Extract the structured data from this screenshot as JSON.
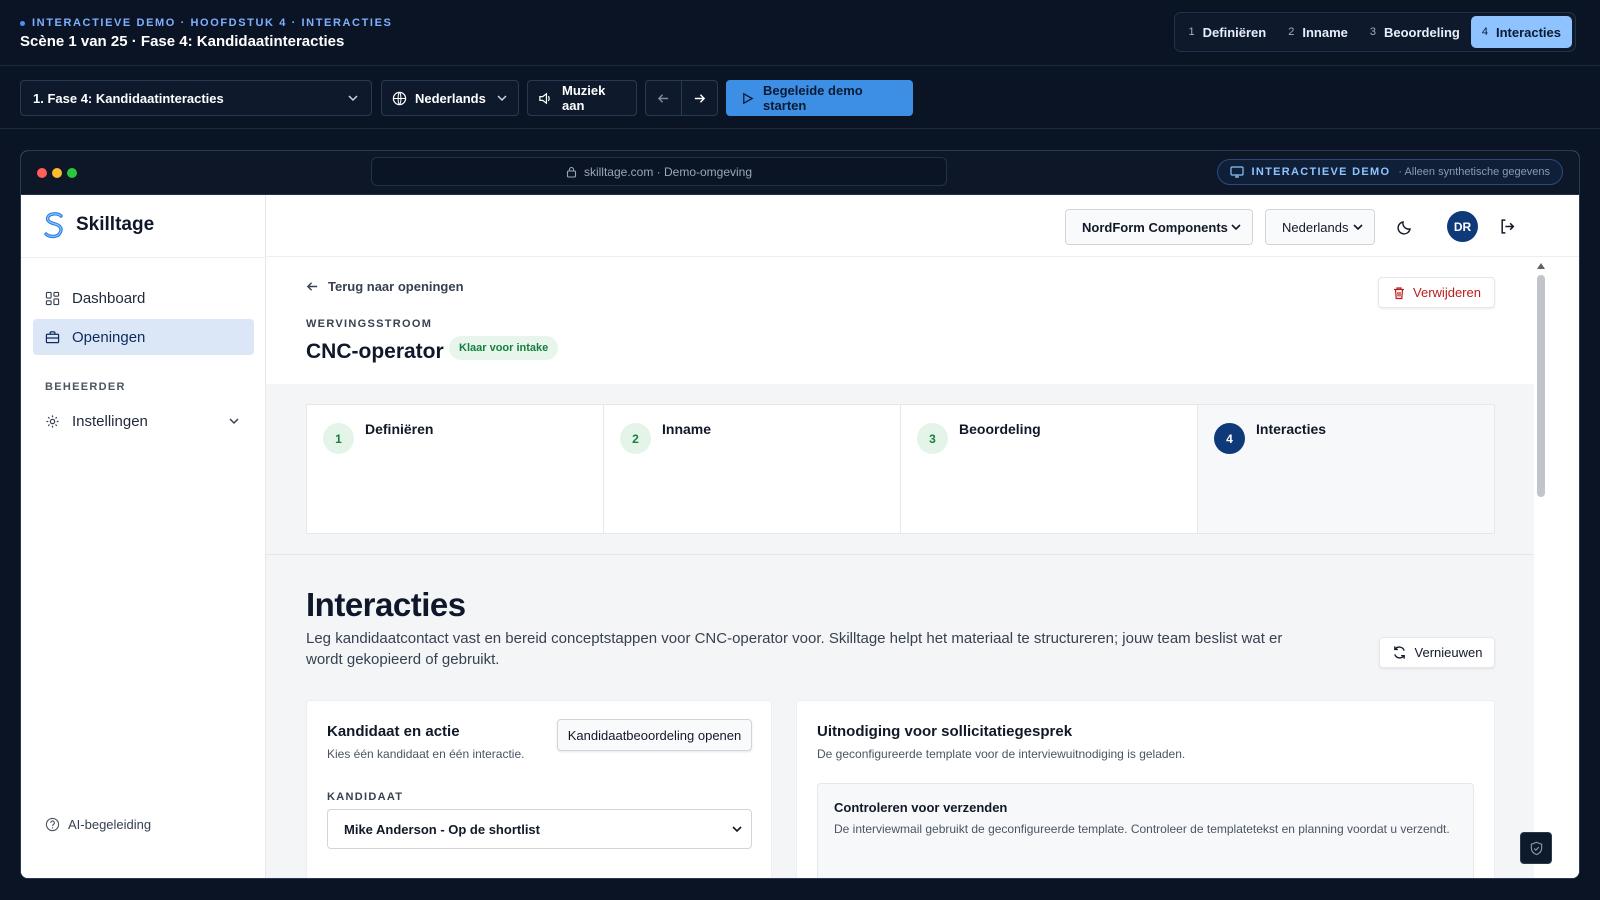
{
  "top": {
    "eyebrow": "INTERACTIEVE DEMO · HOOFDSTUK 4 · INTERACTIES",
    "scene": "Scène 1 van 25 · Fase 4: Kandidaatinteracties",
    "steps": [
      {
        "num": "1",
        "label": "Definiëren"
      },
      {
        "num": "2",
        "label": "Inname"
      },
      {
        "num": "3",
        "label": "Beoordeling"
      },
      {
        "num": "4",
        "label": "Interacties"
      }
    ],
    "chapter_select": "1. Fase 4: Kandidaatinteracties",
    "language": "Nederlands",
    "music": "Muziek aan",
    "start_demo": "Begeleide demo starten"
  },
  "browser": {
    "url": "skilltage.com · Demo-omgeving",
    "demo_badge": "INTERACTIEVE DEMO",
    "demo_note": "· Alleen synthetische gegevens"
  },
  "sidebar": {
    "brand": "Skilltage",
    "items": [
      {
        "label": "Dashboard",
        "icon": "grid-icon"
      },
      {
        "label": "Openingen",
        "icon": "briefcase-icon"
      }
    ],
    "section": "BEHEERDER",
    "settings": "Instellingen",
    "ai_help": "AI-begeleiding"
  },
  "header": {
    "company": "NordForm Components",
    "language": "Nederlands",
    "avatar": "DR"
  },
  "page": {
    "back": "Terug naar openingen",
    "delete": "Verwijderen",
    "flow_label": "WERVINGSSTROOM",
    "title": "CNC-operator",
    "status": "Klaar voor intake",
    "steps": [
      {
        "num": "1",
        "label": "Definiëren"
      },
      {
        "num": "2",
        "label": "Inname"
      },
      {
        "num": "3",
        "label": "Beoordeling"
      },
      {
        "num": "4",
        "label": "Interacties"
      }
    ],
    "heading": "Interacties",
    "intro": "Leg kandidaatcontact vast en bereid conceptstappen voor CNC-operator voor. Skilltage helpt het materiaal te structureren; jouw team beslist wat er wordt gekopieerd of gebruikt.",
    "refresh": "Vernieuwen"
  },
  "candidate_card": {
    "title": "Kandidaat en actie",
    "subtitle": "Kies één kandidaat en één interactie.",
    "open_button": "Kandidaatbeoordeling openen",
    "field_label": "KANDIDAAT",
    "selected": "Mike Anderson - Op de shortlist"
  },
  "invite_card": {
    "title": "Uitnodiging voor sollicitatiegesprek",
    "subtitle": "De geconfigureerde template voor de interviewuitnodiging is geladen.",
    "check_title": "Controleren voor verzenden",
    "check_text": "De interviewmail gebruikt de geconfigureerde template. Controleer de templatetekst en planning voordat u verzendt."
  },
  "colors": {
    "accent": "#3d8fe6",
    "brand": "#0f3a7a",
    "success": "#15803d",
    "danger": "#b91c1c"
  }
}
